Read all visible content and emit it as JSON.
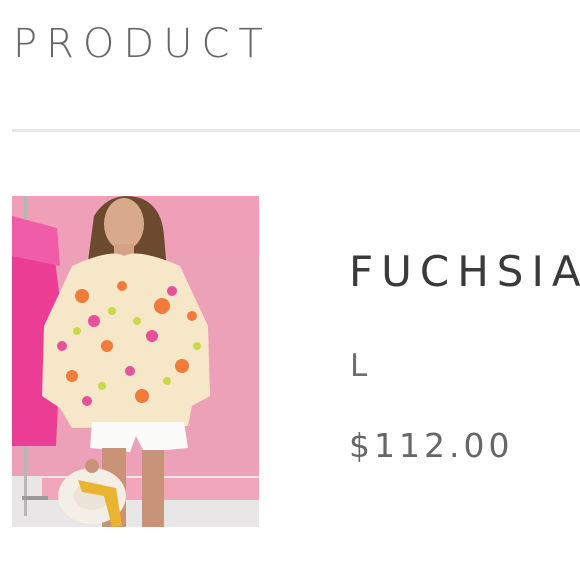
{
  "page": {
    "heading": "PRODUCT"
  },
  "product": {
    "name": "FUCHSIA",
    "size": "L",
    "price": "$112.00",
    "image_icon": "product-photo"
  },
  "colors": {
    "heading_text": "#666666",
    "divider": "#e6e6e6",
    "name_text": "#3a3a3a"
  }
}
